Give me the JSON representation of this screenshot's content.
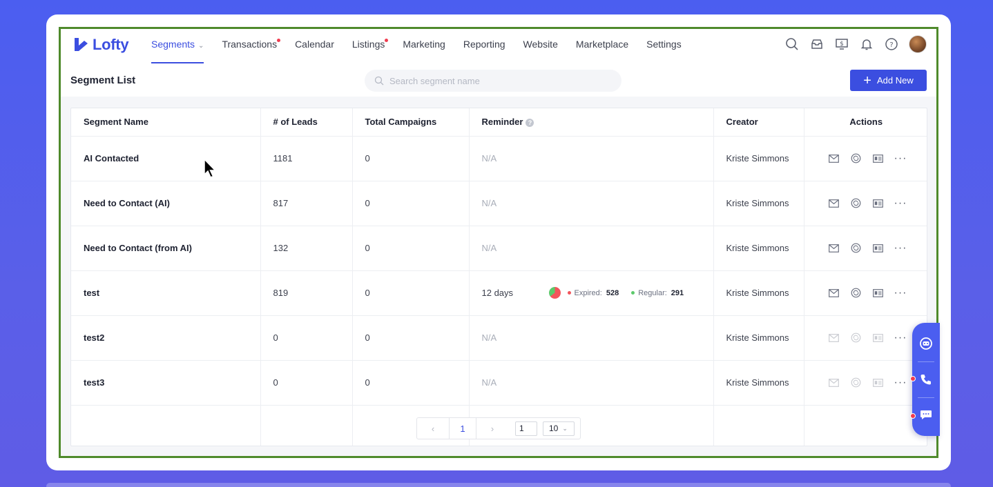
{
  "app": {
    "logo_text": "Lofty",
    "brand_color": "#3b4ee0"
  },
  "nav": {
    "items": [
      {
        "label": "Segments",
        "active": true,
        "dropdown": true
      },
      {
        "label": "Transactions",
        "dot": true
      },
      {
        "label": "Calendar"
      },
      {
        "label": "Listings",
        "dot": true
      },
      {
        "label": "Marketing"
      },
      {
        "label": "Reporting"
      },
      {
        "label": "Website"
      },
      {
        "label": "Marketplace"
      },
      {
        "label": "Settings"
      }
    ],
    "icons": [
      "search-icon",
      "inbox-icon",
      "dollar-monitor-icon",
      "bell-icon",
      "help-icon",
      "avatar"
    ]
  },
  "page": {
    "title": "Segment List",
    "search_placeholder": "Search segment name",
    "add_button": "Add New"
  },
  "table": {
    "headers": [
      "Segment Name",
      "# of Leads",
      "Total Campaigns",
      "Reminder",
      "Creator",
      "Actions"
    ],
    "rows": [
      {
        "name": "AI Contacted",
        "leads": "1181",
        "campaigns": "0",
        "reminder": "N/A",
        "creator": "Kriste Simmons",
        "actions_enabled": true
      },
      {
        "name": "Need to Contact (AI)",
        "leads": "817",
        "campaigns": "0",
        "reminder": "N/A",
        "creator": "Kriste Simmons",
        "actions_enabled": true
      },
      {
        "name": "Need to Contact (from AI)",
        "leads": "132",
        "campaigns": "0",
        "reminder": "N/A",
        "creator": "Kriste Simmons",
        "actions_enabled": true
      },
      {
        "name": "test",
        "leads": "819",
        "campaigns": "0",
        "reminder": "12 days",
        "expired_label": "Expired:",
        "expired": "528",
        "regular_label": "Regular:",
        "regular": "291",
        "creator": "Kriste Simmons",
        "actions_enabled": true
      },
      {
        "name": "test2",
        "leads": "0",
        "campaigns": "0",
        "reminder": "N/A",
        "creator": "Kriste Simmons",
        "actions_enabled": false
      },
      {
        "name": "test3",
        "leads": "0",
        "campaigns": "0",
        "reminder": "N/A",
        "creator": "Kriste Simmons",
        "actions_enabled": false
      }
    ],
    "expired_color": "#f2545b",
    "regular_color": "#5cc96b"
  },
  "pagination": {
    "current_page": "1",
    "jump_value": "1",
    "page_size": "10"
  },
  "float_widget": {
    "icons": [
      "chatbot-icon",
      "phone-icon",
      "message-icon"
    ]
  }
}
